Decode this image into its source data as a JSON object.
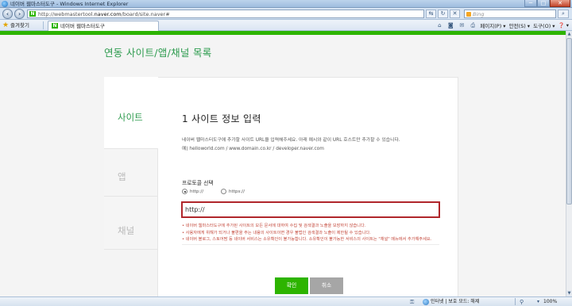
{
  "window": {
    "title": "네이버 웹마스터도구 - Windows Internet Explorer",
    "buttons": [
      "─",
      "□",
      "✕"
    ]
  },
  "address_bar": {
    "url_prefix": "http://webmastertool.",
    "url_domain": "naver.com",
    "url_path": "/board/site.naver#",
    "favicon_letter": "N",
    "search_placeholder": "Bing",
    "icons": [
      "refresh-icon",
      "stop-icon",
      "dropdown-icon"
    ]
  },
  "favorites_bar": {
    "favorites_label": "즐겨찾기",
    "tab_label": "네이버 웹마스터도구",
    "menus": {
      "page": "페이지(P) ▾",
      "safety": "안전(S) ▾",
      "tools": "도구(O) ▾",
      "help": "❓ ▾"
    }
  },
  "page": {
    "title": "연동 사이트/앱/채널 목록",
    "sidenav": {
      "site": "사이트",
      "app": "앱",
      "channel": "채널"
    },
    "section_title": "1 사이트 정보 입력",
    "description_1": "네이버 웹마스터도구에 추가할 사이트 URL을 입력해주세요. 아래 예시와 같이 URL 호스트만 추가할 수 있습니다.",
    "description_2": "예) helloworld.com / www.domain.co.kr / developer.naver.com",
    "protocol_label": "프로토콜 선택",
    "protocol_options": [
      "http://",
      "https://"
    ],
    "selected_protocol": "http://",
    "url_input_value": "http://",
    "notes": [
      "• 네이버 웹마스터도구에 추가된 사이트의 모든 문서에 대하여 수집 및 검색결과 노출을 보장하지 않습니다.",
      "• 사용자에게 위해가 되거나 불편을 주는 내용의 사이트이면 경우 불법인 검색결과 노출이 제한될 수 있습니다.",
      "• 네이버 블로그, 스토어팜 등 네이버 서비스는 소유확인이 불가능합니다. 소유확인이 불가능한 서비스의 사이트는 \"채널\" 메뉴에서 추가해주세요."
    ],
    "ok_button": "확인",
    "cancel_button": "취소"
  },
  "statusbar": {
    "zone": "인터넷 | 보호 모드: 해제",
    "zoom": "100%"
  },
  "colors": {
    "accent_green": "#2db400",
    "title_green": "#2d9b4e",
    "error_red": "#c4493c",
    "input_border": "#b0262b"
  }
}
